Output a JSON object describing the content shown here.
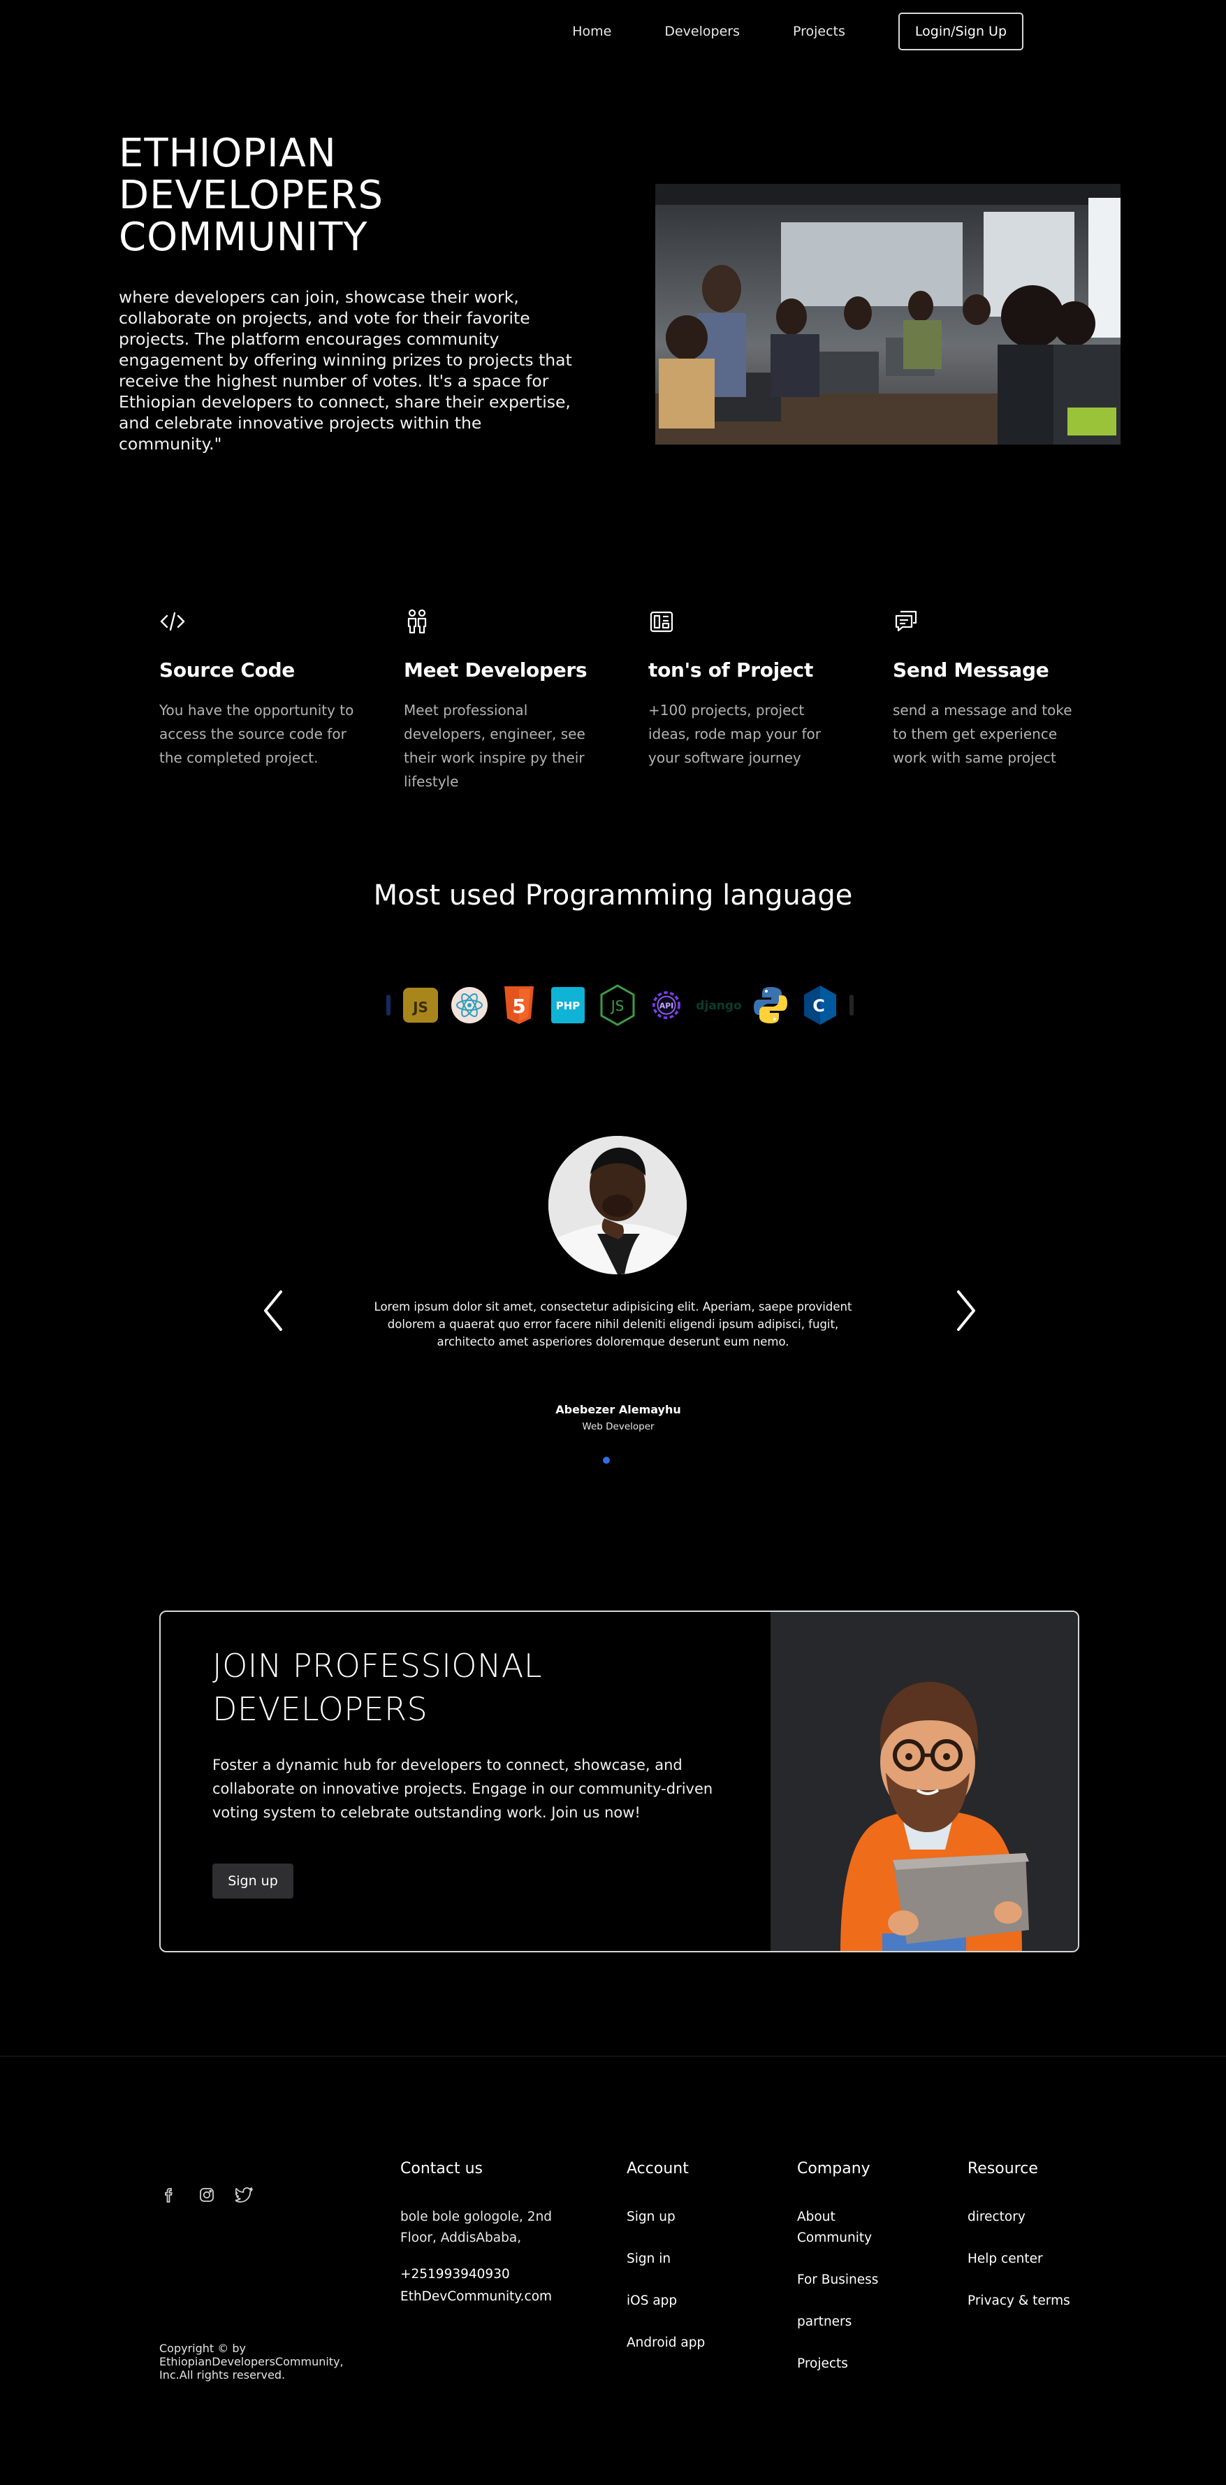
{
  "nav": {
    "links": [
      "Home",
      "Developers",
      "Projects"
    ],
    "login_label": "Login/Sign Up"
  },
  "hero": {
    "title_lines": [
      "ETHIOPIAN",
      "DEVELOPERS",
      "COMMUNITY"
    ],
    "description": "where developers can join, showcase their work, collaborate on projects, and vote for their favorite projects. The platform encourages community engagement by offering winning prizes to projects that receive the highest number of votes. It's a space for Ethiopian developers to connect, share their expertise, and celebrate innovative projects within the community.\""
  },
  "features": [
    {
      "icon": "code-icon",
      "title": "Source Code",
      "text": "You have the opportunity to access the source code for the completed project."
    },
    {
      "icon": "people-icon",
      "title": "Meet Developers",
      "text": "Meet professional developers, engineer, see their work inspire py their lifestyle"
    },
    {
      "icon": "layout-icon",
      "title": "ton's of Project",
      "text": "+100 projects, project ideas, rode map your for your software journey"
    },
    {
      "icon": "messages-icon",
      "title": "Send Message",
      "text": "send a message and toke to them get experience work with same project"
    }
  ],
  "languages": {
    "title": "Most used Programming language",
    "icons": [
      "js-icon",
      "react-icon",
      "html5-icon",
      "php-icon",
      "nodejs-icon",
      "api-icon",
      "django-icon",
      "python-icon",
      "cplusplus-icon"
    ],
    "labels": {
      "js": "JS",
      "html5": "5",
      "php": "PHP",
      "nodejs": "JS",
      "api": "API",
      "django": "django",
      "cplusplus": "C"
    }
  },
  "testimonial": {
    "quote": "Lorem ipsum dolor sit amet, consectetur adipisicing elit. Aperiam, saepe provident dolorem a quaerat quo error facere nihil deleniti eligendi ipsum adipisci, fugit, architecto amet asperiores doloremque deserunt eum nemo.",
    "name": "Abebezer Alemayhu",
    "role": "Web Developer"
  },
  "join": {
    "title": "JOIN PROFESSIONAL DEVELOPERS",
    "text": "Foster a dynamic hub for developers to connect, showcase, and collaborate on innovative projects. Engage in our community-driven voting system to celebrate outstanding work. Join us now!",
    "button": "Sign up"
  },
  "footer": {
    "copyright": "Copyright © by EthiopianDevelopersCommunity, Inc.All rights reserved.",
    "contact": {
      "title": "Contact us",
      "address": "bole bole gologole, 2nd Floor, AddisAbaba,",
      "phone": "+251993940930",
      "email": "EthDevCommunity.com"
    },
    "account": {
      "title": "Account",
      "items": [
        "Sign up",
        "Sign in",
        "iOS app",
        "Android app"
      ]
    },
    "company": {
      "title": "Company",
      "items": [
        "About Community",
        "For Business",
        "partners",
        "Projects"
      ]
    },
    "resource": {
      "title": "Resource",
      "items": [
        "directory",
        "Help center",
        "Privacy & terms"
      ]
    }
  }
}
